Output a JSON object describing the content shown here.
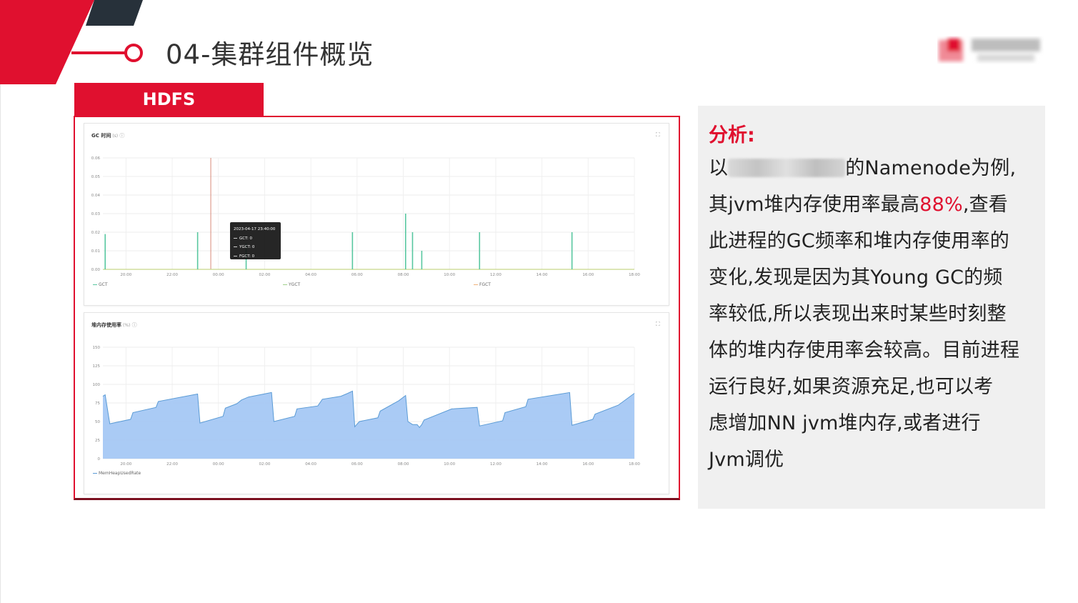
{
  "slide": {
    "title": "04-集群组件概览",
    "tab_label": "HDFS",
    "accent": "#e0102f",
    "dark": "#27313a"
  },
  "gc_chart": {
    "title": "GC 时间",
    "unit": "(s)",
    "legend": [
      "GCT",
      "YGCT",
      "FGCT"
    ],
    "tooltip": {
      "date": "2023-04-17 23:40:00",
      "rows": [
        "GCT:   0",
        "YGCT:   0",
        "FGCT:   0"
      ]
    }
  },
  "heap_chart": {
    "title": "堆内存使用率",
    "unit": "(%)",
    "legend": [
      "MemHeapUsedRate"
    ]
  },
  "chart_data": [
    {
      "type": "bar",
      "title": "GC 时间",
      "ylabel": "(s)",
      "x": [
        "20:00",
        "22:00",
        "00:00",
        "02:00",
        "04:00",
        "06:00",
        "08:00",
        "10:00",
        "12:00",
        "14:00",
        "16:00",
        "18:00"
      ],
      "xlim": [
        19.0,
        42.0
      ],
      "ylim": [
        0,
        0.06
      ],
      "yticks": [
        "0.06",
        "0.05",
        "0.04",
        "0.03",
        "0.02",
        "0.01",
        "0.00"
      ],
      "series": [
        {
          "name": "GCT",
          "color": "#58c7a0",
          "points": [
            [
              19.1,
              0.019
            ],
            [
              23.1,
              0.02
            ],
            [
              25.2,
              0.014
            ],
            [
              29.8,
              0.02
            ],
            [
              32.1,
              0.03
            ],
            [
              32.4,
              0.02
            ],
            [
              32.8,
              0.01
            ],
            [
              35.3,
              0.02
            ],
            [
              39.3,
              0.02
            ]
          ]
        },
        {
          "name": "YGCT",
          "color": "#9fd08a",
          "points": []
        },
        {
          "name": "FGCT",
          "color": "#f0b27a",
          "points": []
        }
      ],
      "marker_x": 23.67,
      "grid": true,
      "legend_position": "bottom-left"
    },
    {
      "type": "area",
      "title": "堆内存使用率",
      "ylabel": "(%)",
      "x": [
        "20:00",
        "22:00",
        "00:00",
        "02:00",
        "04:00",
        "06:00",
        "08:00",
        "10:00",
        "12:00",
        "14:00",
        "16:00",
        "18:00"
      ],
      "xlim": [
        19.0,
        42.0
      ],
      "ylim": [
        0,
        150
      ],
      "yticks": [
        "150",
        "125",
        "100",
        "75",
        "50",
        "25",
        "0"
      ],
      "series": [
        {
          "name": "MemHeapUsedRate",
          "color": "#5b9bd5",
          "fill": "#a5c8f4",
          "points": [
            [
              19.0,
              84
            ],
            [
              19.1,
              86
            ],
            [
              19.3,
              47
            ],
            [
              20.2,
              53
            ],
            [
              20.3,
              62
            ],
            [
              21.3,
              69
            ],
            [
              21.4,
              77
            ],
            [
              22.4,
              83
            ],
            [
              23.1,
              87
            ],
            [
              23.2,
              48
            ],
            [
              24.2,
              57
            ],
            [
              24.3,
              68
            ],
            [
              24.8,
              74
            ],
            [
              25.0,
              79
            ],
            [
              25.3,
              83
            ],
            [
              26.3,
              89
            ],
            [
              26.4,
              50
            ],
            [
              27.3,
              57
            ],
            [
              27.4,
              67
            ],
            [
              28.3,
              71
            ],
            [
              28.5,
              80
            ],
            [
              29.3,
              84
            ],
            [
              29.6,
              88
            ],
            [
              29.8,
              91
            ],
            [
              29.9,
              43
            ],
            [
              30.1,
              50
            ],
            [
              30.9,
              55
            ],
            [
              31.0,
              64
            ],
            [
              31.8,
              78
            ],
            [
              32.1,
              85
            ],
            [
              32.2,
              50
            ],
            [
              32.4,
              46
            ],
            [
              32.6,
              46
            ],
            [
              32.7,
              42
            ],
            [
              32.8,
              46
            ],
            [
              32.9,
              52
            ],
            [
              34.1,
              67
            ],
            [
              35.2,
              69
            ],
            [
              35.3,
              44
            ],
            [
              36.3,
              51
            ],
            [
              36.4,
              62
            ],
            [
              37.3,
              70
            ],
            [
              37.4,
              80
            ],
            [
              38.4,
              85
            ],
            [
              39.2,
              89
            ],
            [
              39.3,
              45
            ],
            [
              40.2,
              53
            ],
            [
              40.3,
              60
            ],
            [
              41.3,
              72
            ],
            [
              42.0,
              88
            ]
          ]
        }
      ],
      "grid": true,
      "legend_position": "bottom-left"
    }
  ],
  "analysis": {
    "heading": "分析:",
    "l1_pre": "以",
    "l1_post": "的Namenode为例,",
    "l2_pre": "其jvm堆内存使用率最高",
    "l2_hl": "88%",
    "l2_post": ",查看",
    "l3": "此进程的GC频率和堆内存使用率的",
    "l4": "变化,发现是因为其Young GC的频",
    "l5": "率较低,所以表现出来时某些时刻整",
    "l6": "体的堆内存使用率会较高。目前进程",
    "l7": "运行良好,如果资源充足,也可以考",
    "l8": "虑增加NN jvm堆内存,或者进行",
    "l9": "Jvm调优"
  }
}
